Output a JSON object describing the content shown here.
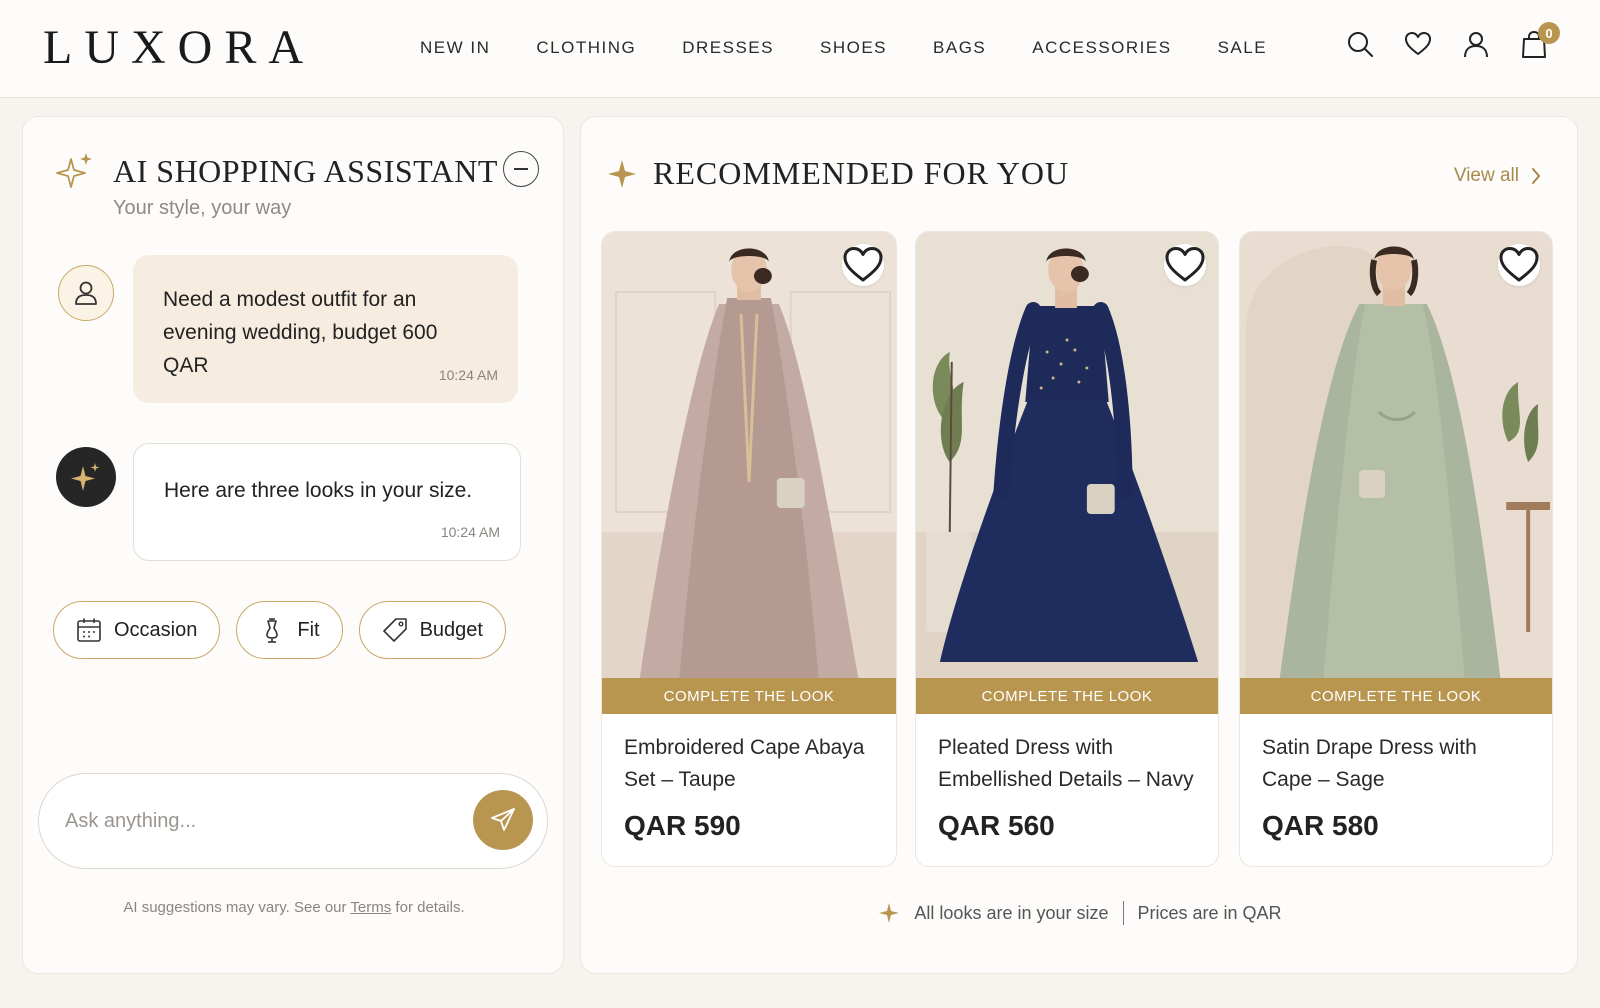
{
  "brand": {
    "logo": "LUXORA"
  },
  "nav": [
    "NEW IN",
    "CLOTHING",
    "DRESSES",
    "SHOES",
    "BAGS",
    "ACCESSORIES",
    "SALE"
  ],
  "header_icons": [
    "search-icon",
    "heart-icon",
    "user-icon",
    "bag-icon"
  ],
  "cart": {
    "count": "0"
  },
  "assistant": {
    "title": "AI SHOPPING ASSISTANT",
    "subtitle": "Your style, your way",
    "messages": [
      {
        "from": "user",
        "text": "Need a modest outfit for an evening wedding, budget 600 QAR",
        "time": "10:24 AM"
      },
      {
        "from": "ai",
        "text": "Here are three looks in your size.",
        "time": "10:24 AM"
      }
    ],
    "chips": [
      {
        "label": "Occasion",
        "icon": "calendar-icon"
      },
      {
        "label": "Fit",
        "icon": "dress-form-icon"
      },
      {
        "label": "Budget",
        "icon": "price-tag-icon"
      }
    ],
    "input_placeholder": "Ask anything...",
    "disclaimer_before": "AI suggestions may vary. See our ",
    "disclaimer_link": "Terms",
    "disclaimer_after": " for details."
  },
  "recommendations": {
    "title": "RECOMMENDED FOR YOU",
    "view_all": "View all",
    "products": [
      {
        "name": "Embroidered Cape Abaya Set – Taupe",
        "price": "QAR 590",
        "cta": "COMPLETE THE LOOK",
        "dress_color": "#b9a098",
        "bg_color": "#ece2d7"
      },
      {
        "name": "Pleated Dress with Embellished Details – Navy",
        "price": "QAR 560",
        "cta": "COMPLETE THE LOOK",
        "dress_color": "#1d2a5a",
        "bg_color": "#e9e0d4"
      },
      {
        "name": "Satin Drape Dress with Cape – Sage",
        "price": "QAR 580",
        "cta": "COMPLETE THE LOOK",
        "dress_color": "#a9b49c",
        "bg_color": "#e8ddd0"
      }
    ],
    "footer_size": "All looks are in your size",
    "footer_prices": "Prices are in QAR"
  },
  "colors": {
    "accent": "#b8964f",
    "background": "#f7f4ef",
    "panel": "#fdfcfa",
    "dark": "#262626"
  }
}
